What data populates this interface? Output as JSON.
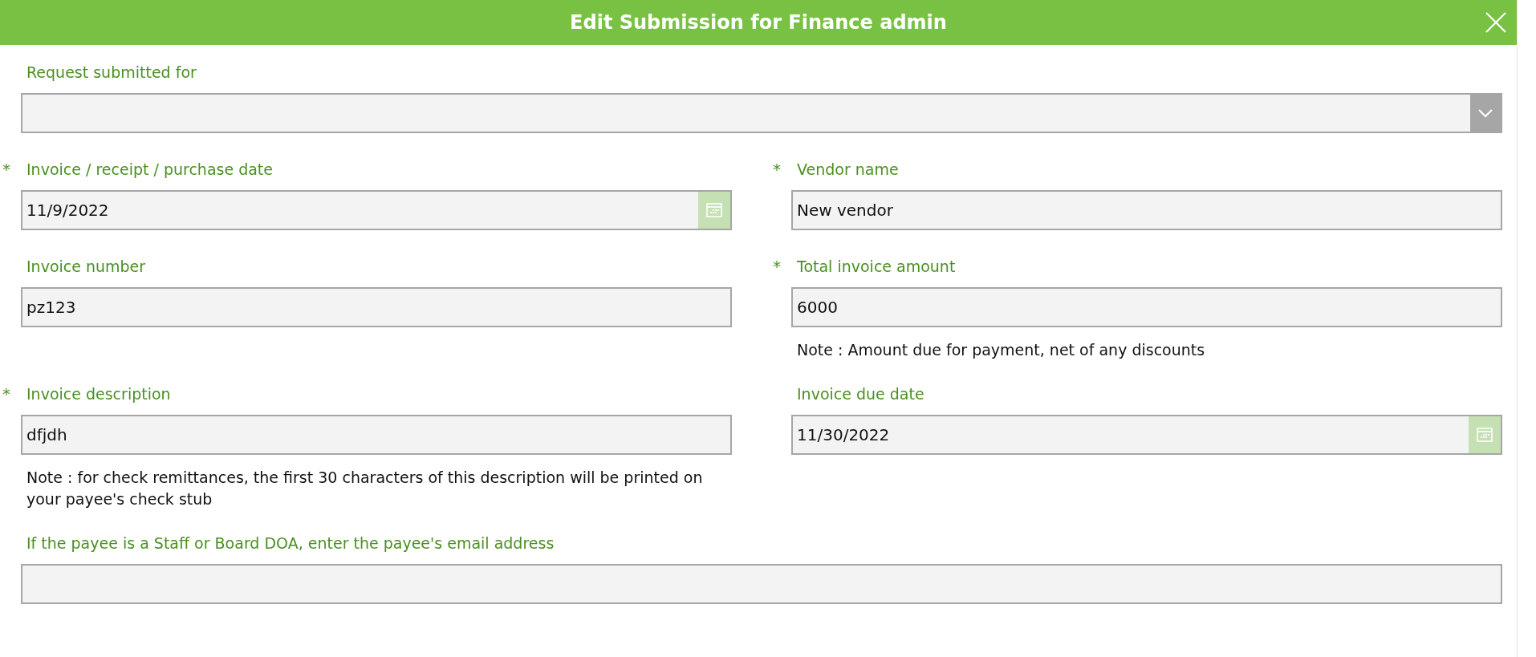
{
  "dialog": {
    "title": "Edit Submission for Finance admin"
  },
  "rows": [
    {
      "fields": [
        {
          "kind": "dropdown",
          "label": "Request submitted for"
        }
      ]
    },
    {
      "fields": [
        {
          "kind": "date",
          "required_mark": "*",
          "label": "Invoice / receipt / purchase date",
          "value": "11/9/2022"
        },
        {
          "kind": "text",
          "required_mark": "*",
          "label": "Vendor name",
          "value": "New vendor"
        }
      ]
    },
    {
      "fields": [
        {
          "kind": "text",
          "label": "Invoice number",
          "value": "pz123"
        },
        {
          "kind": "text",
          "required_mark": "*",
          "label": "Total invoice amount",
          "value": "6000",
          "note": "Note : Amount due for payment, net of any discounts"
        }
      ]
    },
    {
      "fields": [
        {
          "kind": "text",
          "required_mark": "*",
          "label": "Invoice description",
          "value": "dfjdh",
          "note": "Note : for check remittances, the first 30 characters of this description will be printed on your payee's check stub"
        },
        {
          "kind": "date",
          "label": "Invoice due date",
          "value": "11/30/2022"
        }
      ]
    },
    {
      "fields": [
        {
          "kind": "text",
          "label": "If the payee is a Staff or Board DOA, enter the payee's email address"
        }
      ]
    }
  ]
}
